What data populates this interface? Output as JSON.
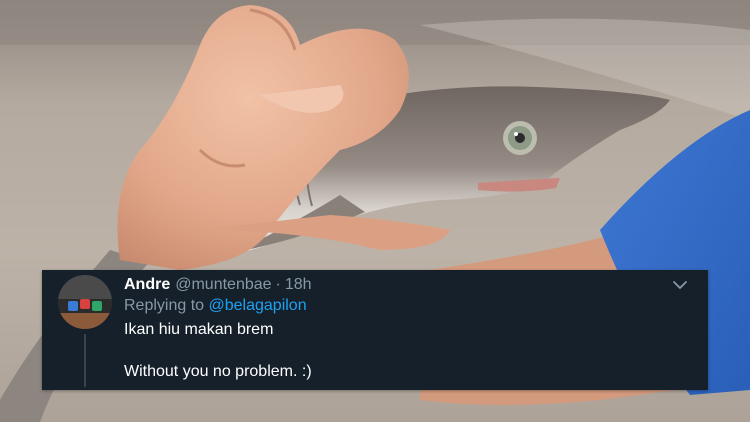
{
  "tweet": {
    "display_name": "Andre",
    "handle": "@muntenbae",
    "separator": "·",
    "time": "18h",
    "replying_prefix": "Replying to",
    "replying_to": "@belagapilon",
    "text_line1": "Ikan hiu makan brem",
    "text_line2": "Without you no problem. :)"
  },
  "colors": {
    "card_bg": "#15202b",
    "secondary_text": "#8899a6",
    "link": "#1da1f2",
    "primary_text": "#ffffff"
  },
  "icons": {
    "caret": "chevron-down-icon",
    "avatar": "avatar-image"
  }
}
